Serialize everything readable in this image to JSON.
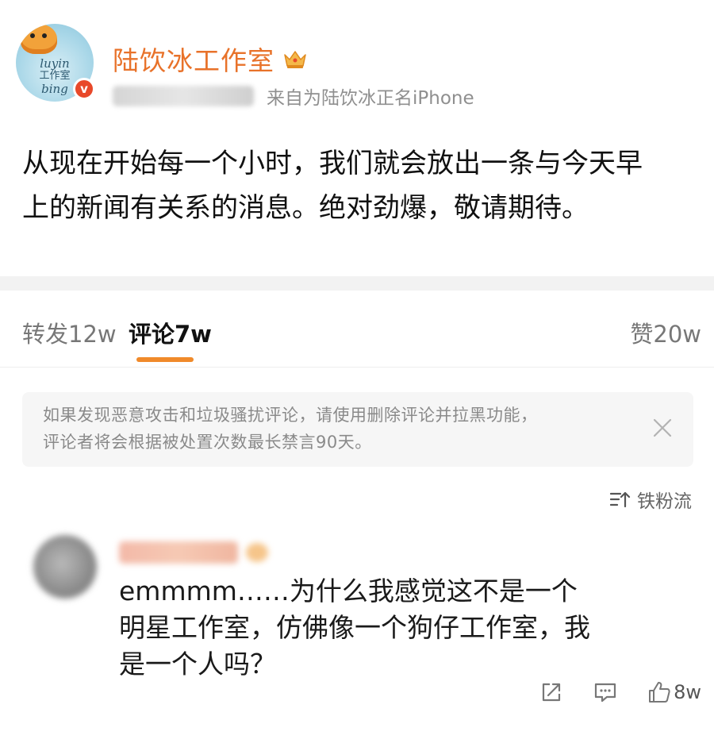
{
  "post": {
    "author": "陆饮冰工作室",
    "source": "来自为陆饮冰正名iPhone",
    "avatar_text_1": "luyin",
    "avatar_text_2": "工作室",
    "avatar_text_3": "bing",
    "verified_mark": "v",
    "content_line1": "从现在开始每一个小时，我们就会放出一条与今天早",
    "content_line2": "上的新闻有关系的消息。绝对劲爆，敬请期待。"
  },
  "tabs": {
    "repost": "转发12w",
    "comment": "评论7w",
    "like": "赞20w"
  },
  "notice": {
    "line1": "如果发现恶意攻击和垃圾骚扰评论，请使用删除评论并拉黑功能，",
    "line2": "评论者将会根据被处置次数最长禁言90天。"
  },
  "sort": {
    "label": "铁粉流"
  },
  "comment": {
    "line1": "emmmm……为什么我感觉这不是一个",
    "line2": "明星工作室，仿佛像一个狗仔工作室，我",
    "line3": "是一个人吗？",
    "like_count": "8w"
  },
  "colors": {
    "accent": "#e8722a",
    "tab_underline": "#f08a2a",
    "verified": "#e8492a"
  },
  "icons": [
    "crown-icon",
    "verified-icon",
    "close-icon",
    "sort-icon",
    "share-icon",
    "comment-icon",
    "like-icon"
  ]
}
